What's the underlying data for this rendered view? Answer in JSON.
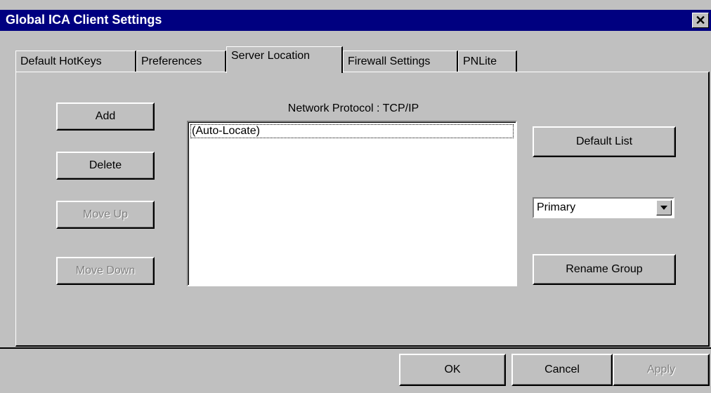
{
  "window": {
    "title": "Global ICA Client Settings",
    "close_glyph": "✕"
  },
  "tabs": [
    {
      "label": "Default HotKeys",
      "active": false
    },
    {
      "label": "Preferences",
      "active": false
    },
    {
      "label": "Server Location",
      "active": true
    },
    {
      "label": "Firewall Settings",
      "active": false
    },
    {
      "label": "PNLite",
      "active": false
    }
  ],
  "left_buttons": {
    "add": {
      "label": "Add",
      "mnemonic": "A",
      "enabled": true
    },
    "delete": {
      "label": "Delete",
      "mnemonic": "D",
      "enabled": true
    },
    "move_up": {
      "label": "Move Up",
      "mnemonic": "U",
      "enabled": false
    },
    "move_down": {
      "label": "Move Down",
      "mnemonic": "w",
      "enabled": false
    }
  },
  "server_list": {
    "label": "Network Protocol : TCP/IP",
    "items": [
      "(Auto-Locate)"
    ],
    "selected_index": 0
  },
  "right_controls": {
    "default_list_label": "Default List",
    "default_list_mnemonic": "L",
    "group_select_value": "Primary",
    "rename_group_label": "Rename Group"
  },
  "footer": {
    "ok_label": "OK",
    "cancel_label": "Cancel",
    "apply_label": "Apply",
    "apply_enabled": false
  },
  "colors": {
    "titlebar": "#000080",
    "face": "#c0c0c0"
  }
}
